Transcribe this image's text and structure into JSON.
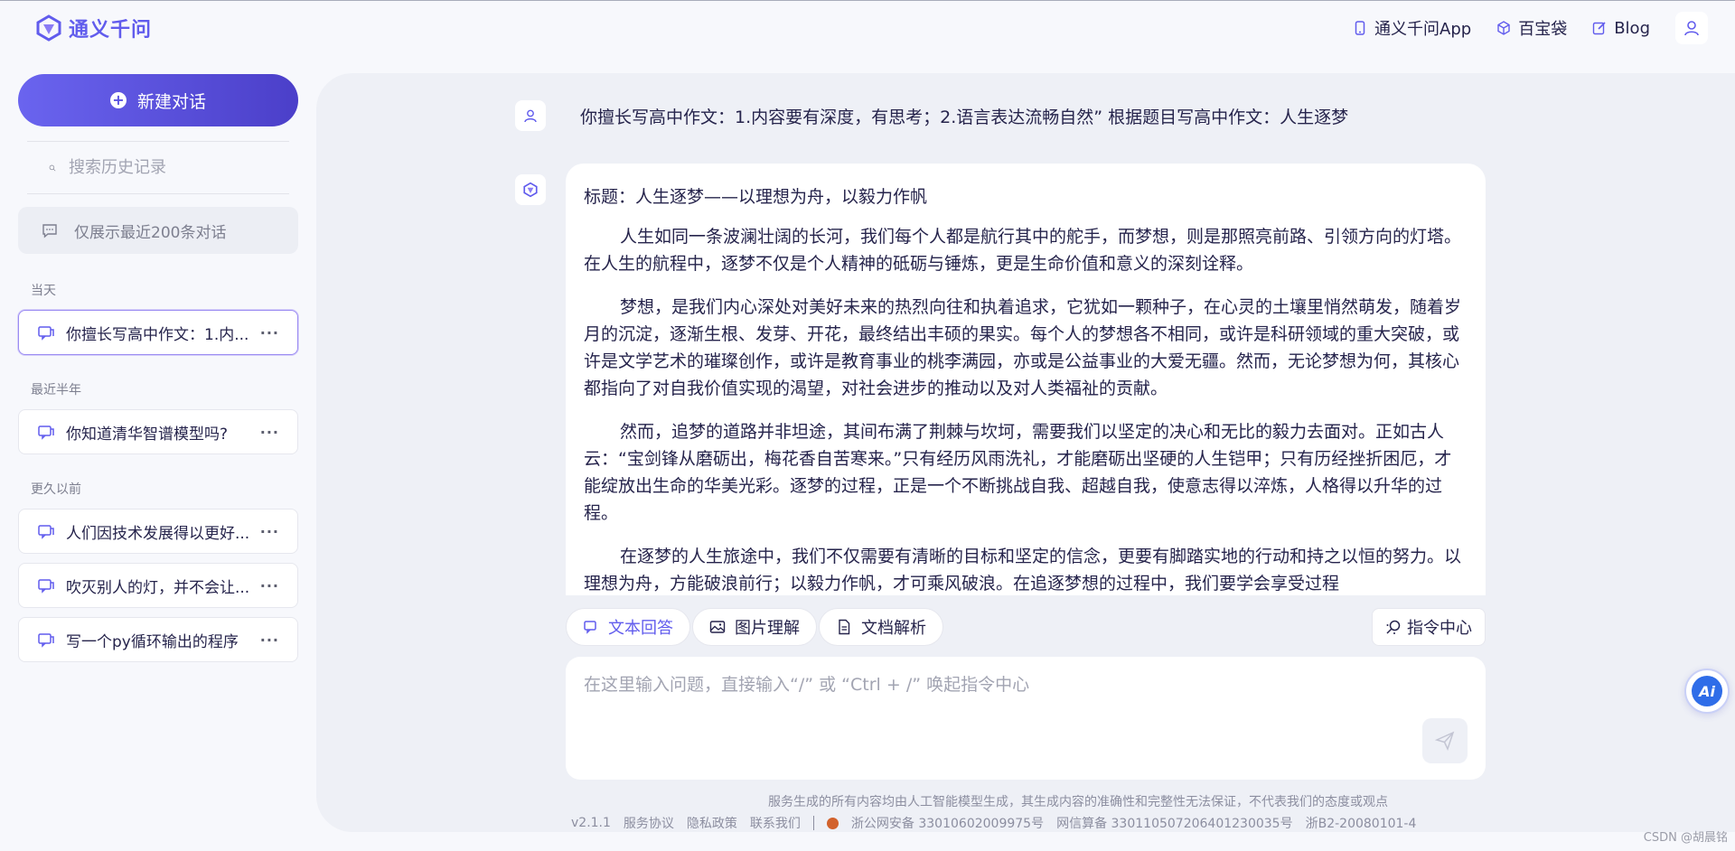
{
  "header": {
    "brand": "通义千问",
    "nav": [
      {
        "label": "通义千问App",
        "icon": "phone-icon"
      },
      {
        "label": "百宝袋",
        "icon": "cube-icon"
      },
      {
        "label": "Blog",
        "icon": "edit-icon"
      }
    ]
  },
  "sidebar": {
    "new_chat_label": "新建对话",
    "search_placeholder": "搜索历史记录",
    "notice": "仅展示最近200条对话",
    "sections": [
      {
        "label": "当天",
        "items": [
          {
            "title": "你擅长写高中作文：1.内...",
            "active": true
          }
        ]
      },
      {
        "label": "最近半年",
        "items": [
          {
            "title": "你知道清华智谱模型吗?",
            "active": false
          }
        ]
      },
      {
        "label": "更久以前",
        "items": [
          {
            "title": "人们因技术发展得以更好...",
            "active": false
          },
          {
            "title": "吹灭别人的灯，并不会让...",
            "active": false
          },
          {
            "title": "写一个py循环输出的程序",
            "active": false
          }
        ]
      }
    ],
    "more_label": "···"
  },
  "chat": {
    "user_message": "你擅长写高中作文：1.内容要有深度，有思考；2.语言表达流畅自然” 根据题目写高中作文：人生逐梦",
    "answer_title": "标题：人生逐梦——以理想为舟，以毅力作帆",
    "answer_paragraphs": [
      "人生如同一条波澜壮阔的长河，我们每个人都是航行其中的舵手，而梦想，则是那照亮前路、引领方向的灯塔。在人生的航程中，逐梦不仅是个人精神的砥砺与锤炼，更是生命价值和意义的深刻诠释。",
      "梦想，是我们内心深处对美好未来的热烈向往和执着追求，它犹如一颗种子，在心灵的土壤里悄然萌发，随着岁月的沉淀，逐渐生根、发芽、开花，最终结出丰硕的果实。每个人的梦想各不相同，或许是科研领域的重大突破，或许是文学艺术的璀璨创作，或许是教育事业的桃李满园，亦或是公益事业的大爱无疆。然而，无论梦想为何，其核心都指向了对自我价值实现的渴望，对社会进步的推动以及对人类福祉的贡献。",
      "然而，追梦的道路并非坦途，其间布满了荆棘与坎坷，需要我们以坚定的决心和无比的毅力去面对。正如古人云：“宝剑锋从磨砺出，梅花香自苦寒来。”只有经历风雨洗礼，才能磨砺出坚硬的人生铠甲；只有历经挫折困厄，才能绽放出生命的华美光彩。逐梦的过程，正是一个不断挑战自我、超越自我，使意志得以淬炼，人格得以升华的过程。",
      "在逐梦的人生旅途中，我们不仅需要有清晰的目标和坚定的信念，更要有脚踏实地的行动和持之以恒的努力。以理想为舟，方能破浪前行；以毅力作帆，才可乘风破浪。在追逐梦想的过程中，我们要学会享受过程"
    ]
  },
  "tools": {
    "items": [
      {
        "label": "文本回答",
        "active": true
      },
      {
        "label": "图片理解",
        "active": false
      },
      {
        "label": "文档解析",
        "active": false
      }
    ],
    "command_center": "指令中心"
  },
  "input": {
    "placeholder": "在这里输入问题，直接输入“/” 或 “Ctrl + /” 唤起指令中心"
  },
  "footer": {
    "disclaimer": "服务生成的所有内容均由人工智能模型生成，其生成内容的准确性和完整性无法保证，不代表我们的态度或观点",
    "version": "v2.1.1",
    "links": [
      "服务协议",
      "隐私政策",
      "联系我们"
    ],
    "police_record": "浙公网安备 33010602009975号",
    "algo_record": "网信算备 330110507206401230035号",
    "icp": "浙B2-20080101-4"
  },
  "floating": {
    "ai_label": "Ai"
  },
  "watermark": "CSDN @胡晨铭",
  "colors": {
    "accent": "#615ced",
    "background": "#f7f8fc",
    "panel": "#eef0f6"
  }
}
